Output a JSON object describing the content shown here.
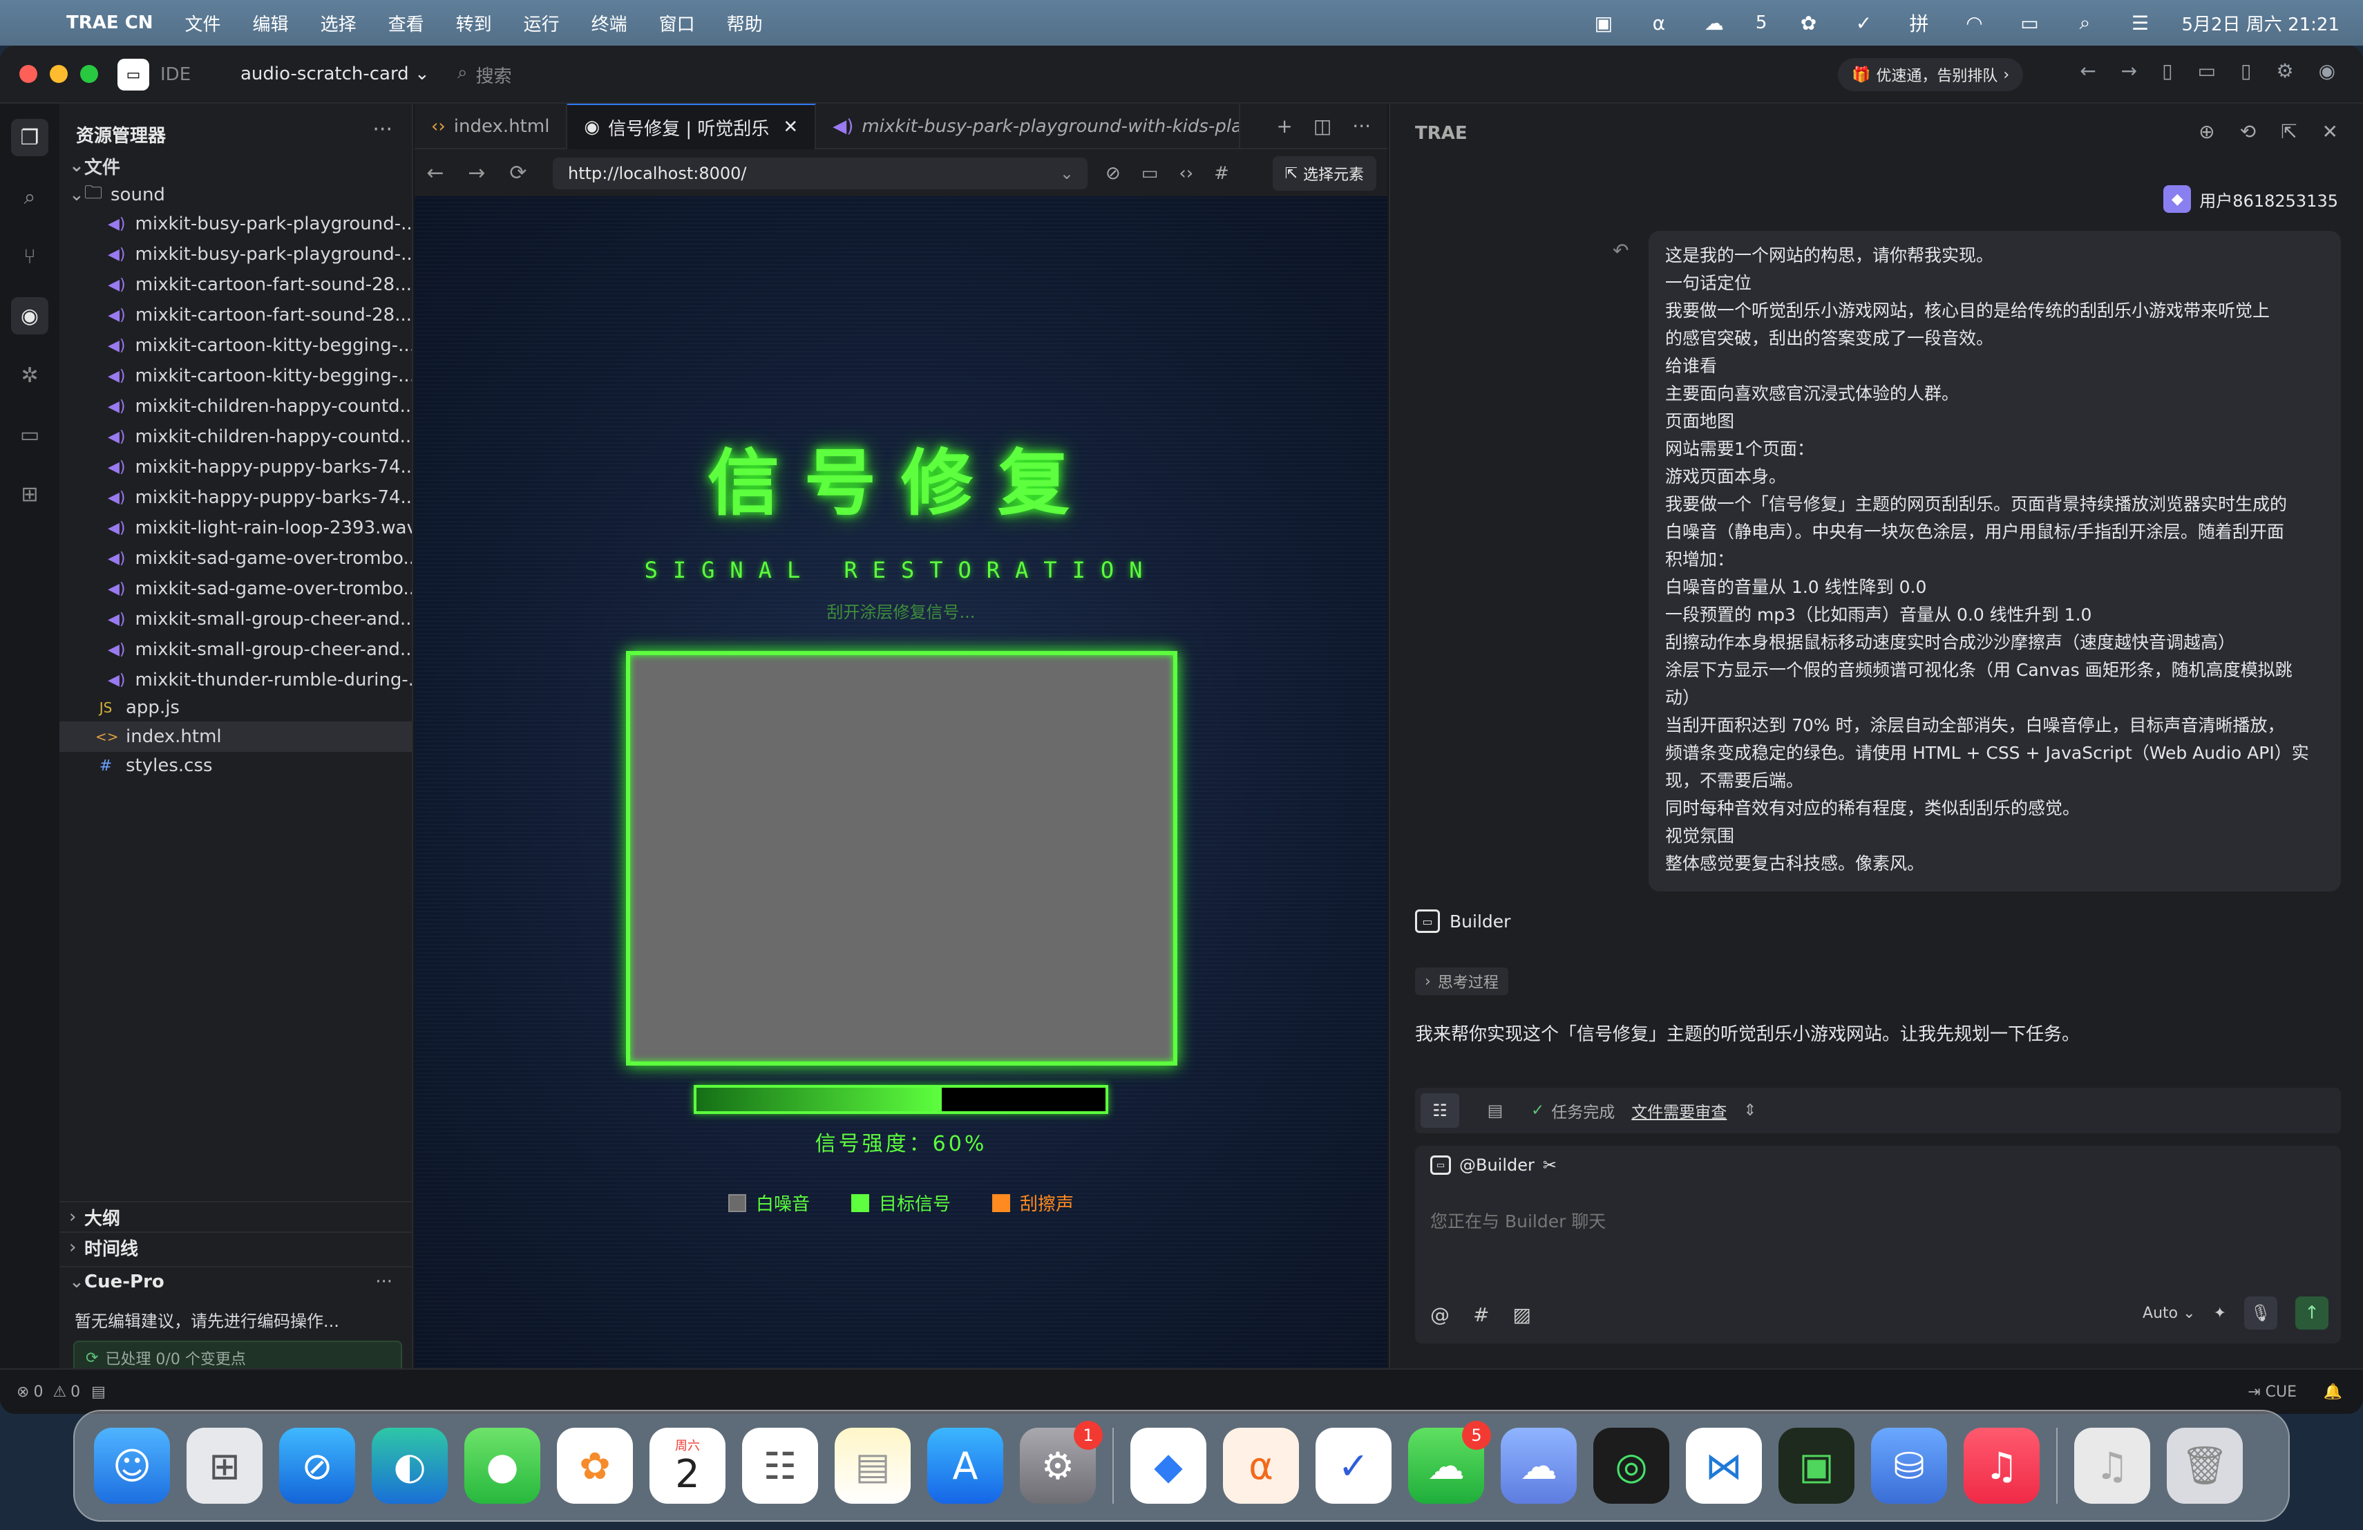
{
  "menubar": {
    "app_name": "TRAE CN",
    "items": [
      "文件",
      "编辑",
      "选择",
      "查看",
      "转到",
      "运行",
      "终端",
      "窗口",
      "帮助"
    ],
    "battery_like_count": "5",
    "datetime": "5月2日 周六 21:21"
  },
  "titlebar": {
    "mode": "IDE",
    "project": "audio-scratch-card",
    "search_placeholder": "搜索",
    "promo": "优速通，告别排队"
  },
  "explorer": {
    "title": "资源管理器",
    "root": "文件",
    "folder": "sound",
    "sound_files": [
      "mixkit-busy-park-playground-...",
      "mixkit-busy-park-playground-...",
      "mixkit-cartoon-fart-sound-28...",
      "mixkit-cartoon-fart-sound-28...",
      "mixkit-cartoon-kitty-begging-...",
      "mixkit-cartoon-kitty-begging-...",
      "mixkit-children-happy-countd...",
      "mixkit-children-happy-countd...",
      "mixkit-happy-puppy-barks-74...",
      "mixkit-happy-puppy-barks-74...",
      "mixkit-light-rain-loop-2393.wav",
      "mixkit-sad-game-over-trombo...",
      "mixkit-sad-game-over-trombo...",
      "mixkit-small-group-cheer-and...",
      "mixkit-small-group-cheer-and...",
      "mixkit-thunder-rumble-during-..."
    ],
    "files": [
      {
        "icon": "JS",
        "name": "app.js"
      },
      {
        "icon": "<>",
        "name": "index.html"
      },
      {
        "icon": "#",
        "name": "styles.css"
      }
    ],
    "outline": "大纲",
    "timeline": "时间线",
    "cue_title": "Cue-Pro",
    "cue_message": "暂无编辑建议，请先进行编码操作...",
    "cue_status": "已处理 0/0 个变更点"
  },
  "editor": {
    "tabs": [
      "index.html",
      "信号修复 | 听觉刮乐",
      "mixkit-busy-park-playground-with-kids-playir"
    ],
    "url": "http://localhost:8000/",
    "select_element": "选择元素"
  },
  "game": {
    "title": "信号修复",
    "subtitle": "SIGNAL RESTORATION",
    "hint": "刮开涂层修复信号...",
    "strength_label": "信号强度：60%",
    "strength_fraction": 0.6,
    "legend": [
      {
        "label": "白噪音",
        "color": "#6b6b6b"
      },
      {
        "label": "目标信号",
        "color": "#5dff3e"
      },
      {
        "label": "刮擦声",
        "color": "#ff8a1f"
      }
    ]
  },
  "chat": {
    "title": "TRAE",
    "user": "用户8618253135",
    "user_message_lines": [
      "这是我的一个网站的构思，请你帮我实现。",
      "一句话定位",
      "我要做一个听觉刮乐小游戏网站，核心目的是给传统的刮刮乐小游戏带来听觉上",
      "的感官突破，刮出的答案变成了一段音效。",
      "给谁看",
      "主要面向喜欢感官沉浸式体验的人群。",
      "页面地图",
      "网站需要1个页面：",
      "游戏页面本身。",
      "我要做一个「信号修复」主题的网页刮刮乐。页面背景持续播放浏览器实时生成的",
      "白噪音（静电声）。中央有一块灰色涂层，用户用鼠标/手指刮开涂层。随着刮开面",
      "积增加：",
      "白噪音的音量从 1.0 线性降到 0.0",
      "一段预置的 mp3（比如雨声）音量从 0.0 线性升到 1.0",
      "刮擦动作本身根据鼠标移动速度实时合成沙沙摩擦声（速度越快音调越高）",
      "涂层下方显示一个假的音频频谱可视化条（用 Canvas 画矩形条，随机高度模拟跳",
      "动）",
      "当刮开面积达到 70% 时，涂层自动全部消失，白噪音停止，目标声音清晰播放，",
      "频谱条变成稳定的绿色。请使用 HTML + CSS + JavaScript（Web Audio API）实",
      "现，不需要后端。",
      "同时每种音效有对应的稀有程度，类似刮刮乐的感觉。",
      "视觉氛围",
      "整体感觉要复古科技感。像素风。"
    ],
    "builder": "Builder",
    "think": "思考过程",
    "reply": "我来帮你实现这个「信号修复」主题的听觉刮乐小游戏网站。让我先规划一下任务。",
    "task_status": "任务完成",
    "task_link": "文件需要审查",
    "at_builder": "@Builder",
    "input_placeholder": "您正在与 Builder 聊天",
    "model": "Auto"
  },
  "statusbar": {
    "errors": "0",
    "warnings": "0",
    "cue": "CUE"
  },
  "dock": {
    "calendar_weekday": "周六",
    "calendar_day": "2",
    "settings_badge": "1",
    "wechat_badge": "5"
  }
}
